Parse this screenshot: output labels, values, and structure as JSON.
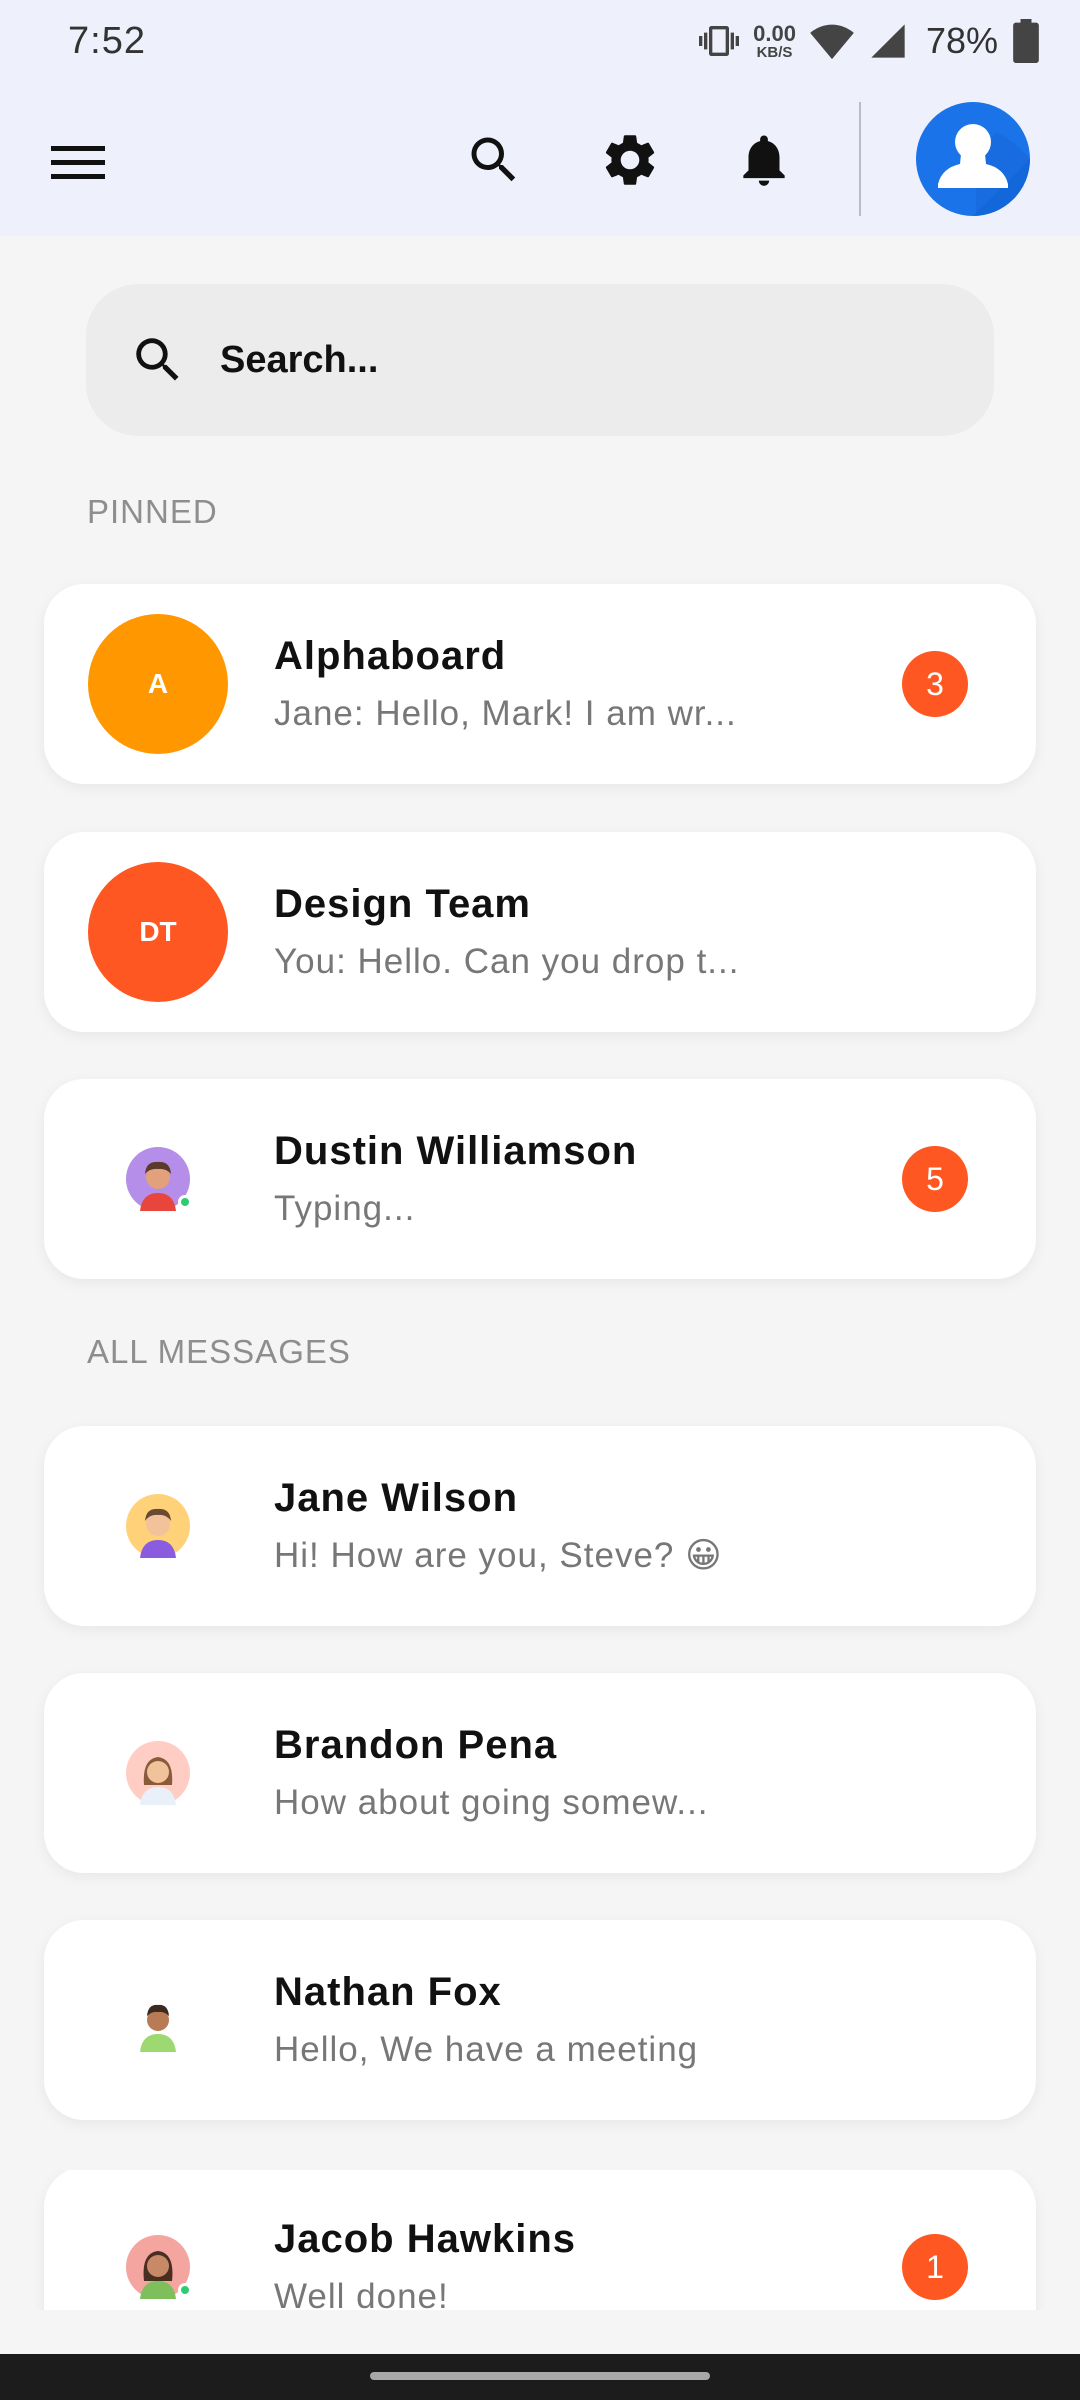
{
  "status_bar": {
    "time": "7:52",
    "net_speed_value": "0.00",
    "net_speed_unit": "KB/S",
    "battery": "78%",
    "icons": [
      "vibrate-icon",
      "wifi-icon",
      "signal-icon",
      "battery-icon"
    ]
  },
  "app_bar": {
    "icons": [
      "menu-icon",
      "search-icon",
      "gear-icon",
      "bell-icon",
      "profile-avatar"
    ],
    "accent": "#1a73e8"
  },
  "search": {
    "placeholder": "Search..."
  },
  "sections": {
    "pinned": "PINNED",
    "all_messages": "ALL MESSAGES"
  },
  "pinned": [
    {
      "name": "Alphaboard",
      "preview": "Jane: Hello, Mark! I am wr...",
      "initials": "A",
      "avatar_color": "#ff9800",
      "badge": "3"
    },
    {
      "name": "Design Team",
      "preview": "You: Hello. Can you drop t...",
      "initials": "DT",
      "avatar_color": "#ff5722",
      "badge": ""
    },
    {
      "name": "Dustin Williamson",
      "preview": "Typing...",
      "avatar": "user-avatar-male-purple",
      "online": true,
      "badge": "5"
    }
  ],
  "messages": [
    {
      "name": "Jane Wilson",
      "preview": "Hi! How are you, Steve? 😀",
      "avatar": "user-avatar-male-yellow"
    },
    {
      "name": "Brandon Pena",
      "preview": "How about going somew...",
      "avatar": "user-avatar-female-pink"
    },
    {
      "name": "Nathan Fox",
      "preview": "Hello, We have a meeting",
      "avatar": "user-avatar-male-green"
    },
    {
      "name": "Jacob Hawkins",
      "preview": "Well done!",
      "avatar": "user-avatar-female-red",
      "online": true,
      "badge": "1"
    }
  ],
  "colors": {
    "badge": "#ff5722",
    "online": "#2ecc71",
    "header_bg": "#eef1fb"
  }
}
